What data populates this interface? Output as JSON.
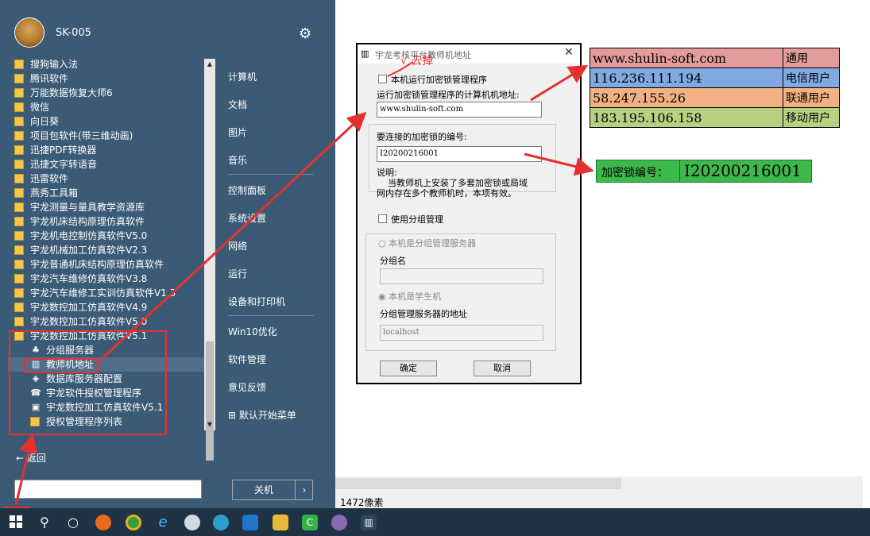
{
  "start_menu": {
    "user_name": "SK-005",
    "apps": [
      "搜狗输入法",
      "腾讯软件",
      "万能数据恢复大师6",
      "微信",
      "向日葵",
      "项目包软件(带三维动画)",
      "迅捷PDF转换器",
      "迅捷文字转语音",
      "迅雷软件",
      "燕秀工具箱",
      "宇龙测量与量具教学资源库",
      "宇龙机床结构原理仿真软件",
      "宇龙机电控制仿真软件V5.0",
      "宇龙机械加工仿真软件V2.3",
      "宇龙普通机床结构原理仿真软件",
      "宇龙汽车维修仿真软件V3.8",
      "宇龙汽车维修工实训仿真软件V1.3",
      "宇龙数控加工仿真软件V4.9",
      "宇龙数控加工仿真软件V5.0",
      "宇龙数控加工仿真软件V5.1"
    ],
    "subitems": [
      {
        "label": "分组服务器",
        "icon": "server-icon"
      },
      {
        "label": "教师机地址",
        "icon": "teacher-address-icon"
      },
      {
        "label": "数据库服务器配置",
        "icon": "database-icon"
      },
      {
        "label": "宇龙软件授权管理程序",
        "icon": "license-icon"
      },
      {
        "label": "宇龙数控加工仿真软件V5.1",
        "icon": "app-icon"
      },
      {
        "label": "授权管理程序列表",
        "icon": "folder-icon"
      }
    ],
    "nav": [
      "计算机",
      "文档",
      "图片",
      "音乐",
      "控制面板",
      "系统设置",
      "网络",
      "运行",
      "设备和打印机",
      "Win10优化",
      "软件管理",
      "意见反馈",
      "默认开始菜单"
    ],
    "back": "返回",
    "shutdown": "关机"
  },
  "status": {
    "pixels": "1472像素"
  },
  "dialog": {
    "title": "宇龙考核平台教师机地址",
    "run_lock_label": "本机运行加密锁管理程序",
    "computer_addr_label": "运行加密锁管理程序的计算机机地址:",
    "computer_addr_value": "www.shulin-soft.com",
    "lock_no_label": "要连接的加密锁的编号:",
    "lock_no_value": "I20200216001",
    "note_title": "说明:",
    "note_text1": "当教师机上安装了多套加密锁或局域",
    "note_text2": "网内存在多个教师机时，本项有效。",
    "use_group_label": "使用分组管理",
    "group_server_label": "本机是分组管理服务器",
    "group_name_label": "分组名",
    "group_name_value": "",
    "student_label": "本机是学生机",
    "group_server_addr_label": "分组管理服务器的地址",
    "group_server_addr_value": "localhost",
    "ok": "确定",
    "cancel": "取消"
  },
  "annotation": "√ 去掉",
  "servers": [
    {
      "address": "www.shulin-soft.com",
      "type": "通用",
      "color": "#e49b9b"
    },
    {
      "address": "116.236.111.194",
      "type": "电信用户",
      "color": "#7fa9e0"
    },
    {
      "address": "58.247.155.26",
      "type": "联通用户",
      "color": "#f2b183"
    },
    {
      "address": "183.195.106.158",
      "type": "移动用户",
      "color": "#b6d17f"
    }
  ],
  "lock_box": {
    "label": "加密锁编号：",
    "value": "I20200216001"
  }
}
